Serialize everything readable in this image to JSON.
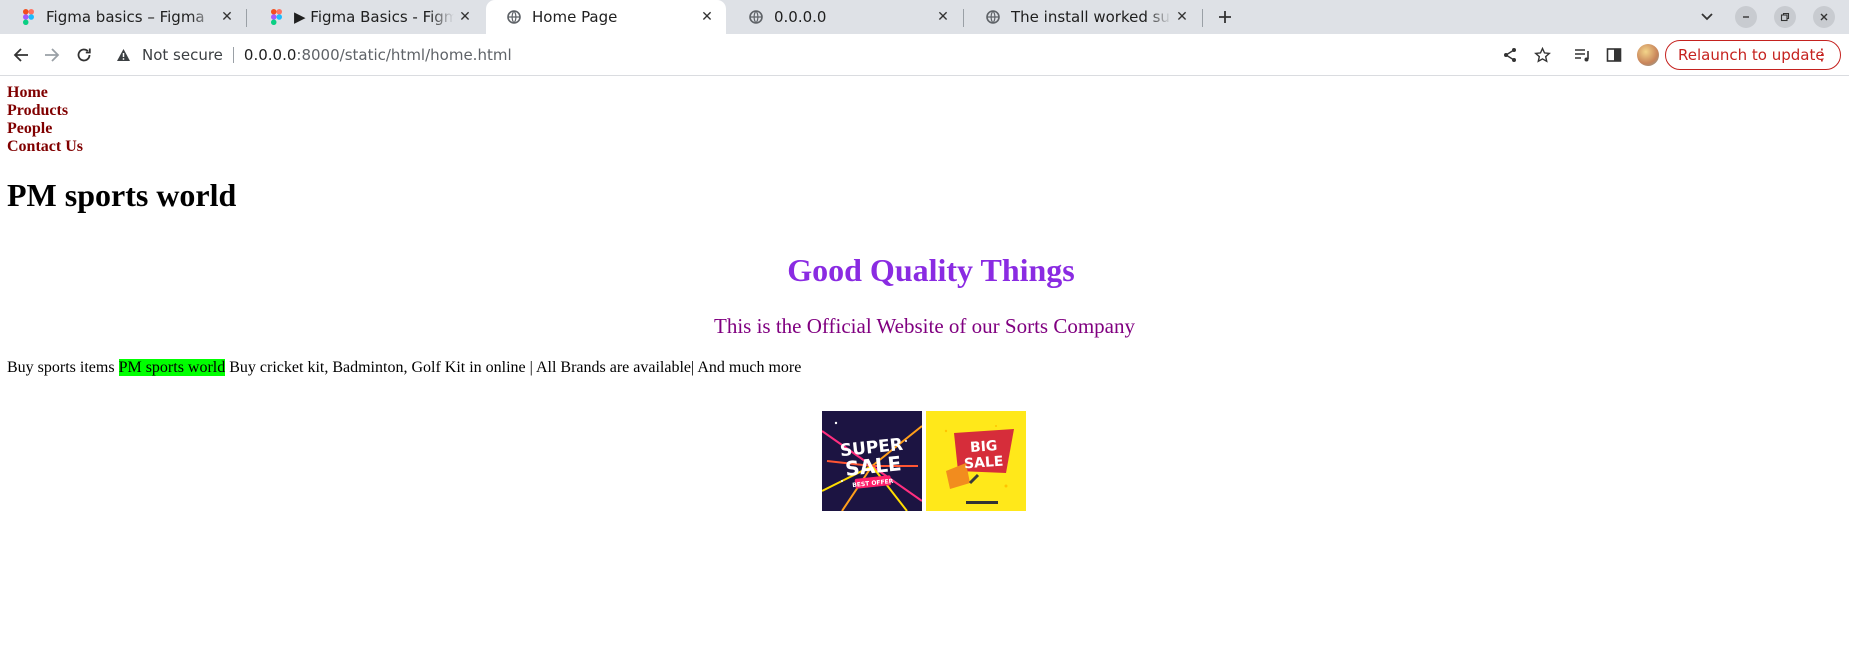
{
  "browser": {
    "tabs": [
      {
        "title": "Figma basics – Figma",
        "icon": "figma-icon",
        "active": false
      },
      {
        "title": "▶ Figma Basics - Figma basics",
        "icon": "figma-icon",
        "active": false
      },
      {
        "title": "Home Page",
        "icon": "globe-icon",
        "active": true
      },
      {
        "title": "0.0.0.0",
        "icon": "globe-icon",
        "active": false
      },
      {
        "title": "The install worked successfully",
        "icon": "globe-icon",
        "active": false
      }
    ],
    "address_bar": {
      "security_label": "Not secure",
      "url_host": "0.0.0.0",
      "url_path": ":8000/static/html/home.html"
    },
    "relaunch_label": "Relaunch to update",
    "colors": {
      "relaunch": "#c5221f",
      "tabstrip": "#dee1e6"
    }
  },
  "page": {
    "nav": [
      "Home",
      "Products",
      "People",
      "Contact Us"
    ],
    "site_title": "PM sports world",
    "tagline": "Good Quality Things",
    "subtitle": "This is the Official Website of our Sorts Company",
    "description": {
      "before": "Buy sports items ",
      "highlight": "PM sports world",
      "after": " Buy cricket kit, Badminton, Golf Kit in online | All Brands are available| And much more"
    },
    "promos": [
      {
        "line1": "SUPER",
        "line2": "SALE",
        "badge": "BEST OFFER"
      },
      {
        "line1": "BIG",
        "line2": "SALE"
      }
    ],
    "colors": {
      "nav": "#800000",
      "tagline": "#8a2be2",
      "subtitle": "#800080",
      "highlight": "#00ff00"
    }
  }
}
